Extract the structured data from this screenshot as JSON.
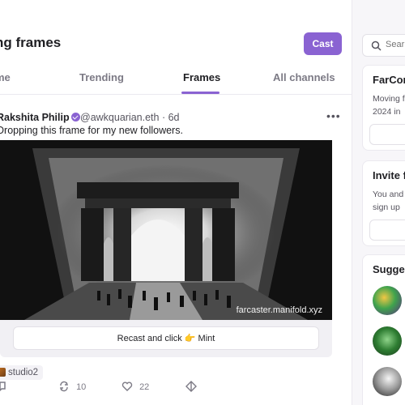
{
  "header": {
    "title": "ng frames",
    "cast_label": "Cast"
  },
  "tabs": [
    {
      "label": "me"
    },
    {
      "label": "Trending"
    },
    {
      "label": "Frames"
    },
    {
      "label": "All channels"
    }
  ],
  "post": {
    "author": "Rakshita Philip",
    "handle": "@awkquarian.eth · 6d",
    "text": "Dropping this frame for my new followers.",
    "more": "•••",
    "frame_url": "farcaster.manifold.xyz",
    "frame_button": "Recast and click 👉 Mint",
    "channel": "studio2",
    "recasts": "10",
    "likes": "22"
  },
  "sidebar": {
    "search_placeholder": "Sear",
    "card1": {
      "title": "FarCon",
      "line1": "Moving f",
      "line2": "2024 in"
    },
    "card2": {
      "title": "Invite f",
      "line1": "You and",
      "line2": "sign up"
    },
    "suggested_title": "Sugge"
  },
  "colors": {
    "accent": "#8a63d2"
  },
  "icons": [
    "verified-badge-icon",
    "more-icon",
    "recast-icon",
    "like-icon",
    "diamond-icon",
    "search-icon"
  ]
}
